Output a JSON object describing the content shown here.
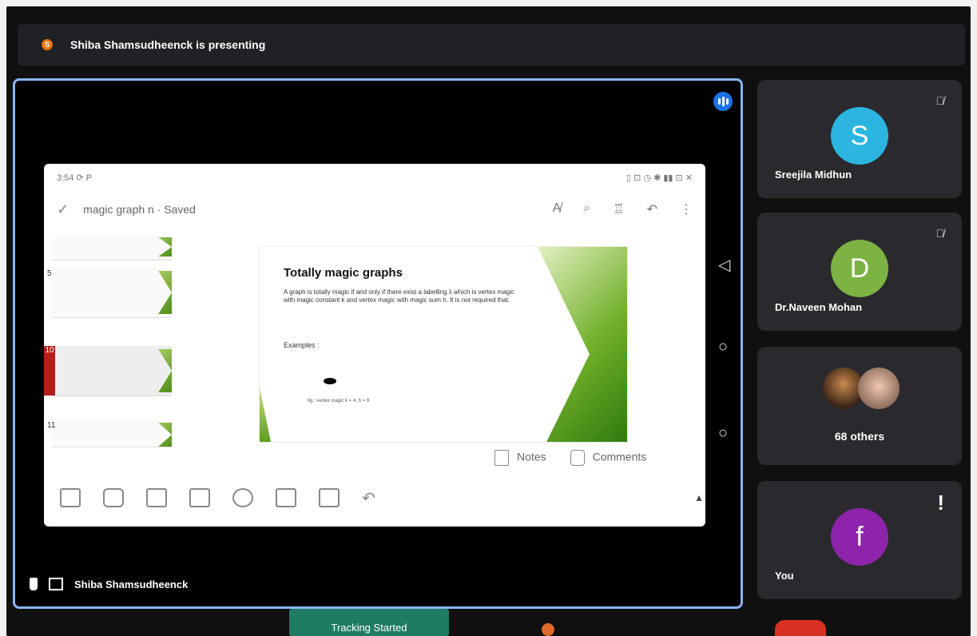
{
  "presenting": {
    "avatar_initial": "S",
    "text": "Shiba Shamsudheenck is presenting"
  },
  "shared_screen": {
    "status_time": "3:54 ⟳ P",
    "status_icons": "▯ ⊡ ◷ ✱ ▮▮ ⊡ ✕",
    "file_title": "magic graph n · Saved",
    "slide": {
      "title": "Totally magic graphs",
      "body": "A graph is totally magic if and only if there exist a labelling λ which is vertex magic with magic constant k and vertex magic with magic sum h. It is not required that.",
      "examples_label": "Examples :",
      "caption": "fig.: vertex magic  k = 4,  h = 9"
    },
    "thumbnails": [
      "5",
      "10",
      "11"
    ],
    "notes_label": "Notes",
    "comments_label": "Comments",
    "presenter_name": "Shiba Shamsudheenck"
  },
  "participants": [
    {
      "initial": "S",
      "name": "Sreejila Midhun",
      "color": "#2bb5e0"
    },
    {
      "initial": "D",
      "name": "Dr.Naveen Mohan",
      "color": "#7cb342"
    },
    {
      "others_label": "68 others"
    },
    {
      "initial": "f",
      "name": "You",
      "color": "#8e24aa"
    }
  ],
  "toast": "Tracking Started"
}
